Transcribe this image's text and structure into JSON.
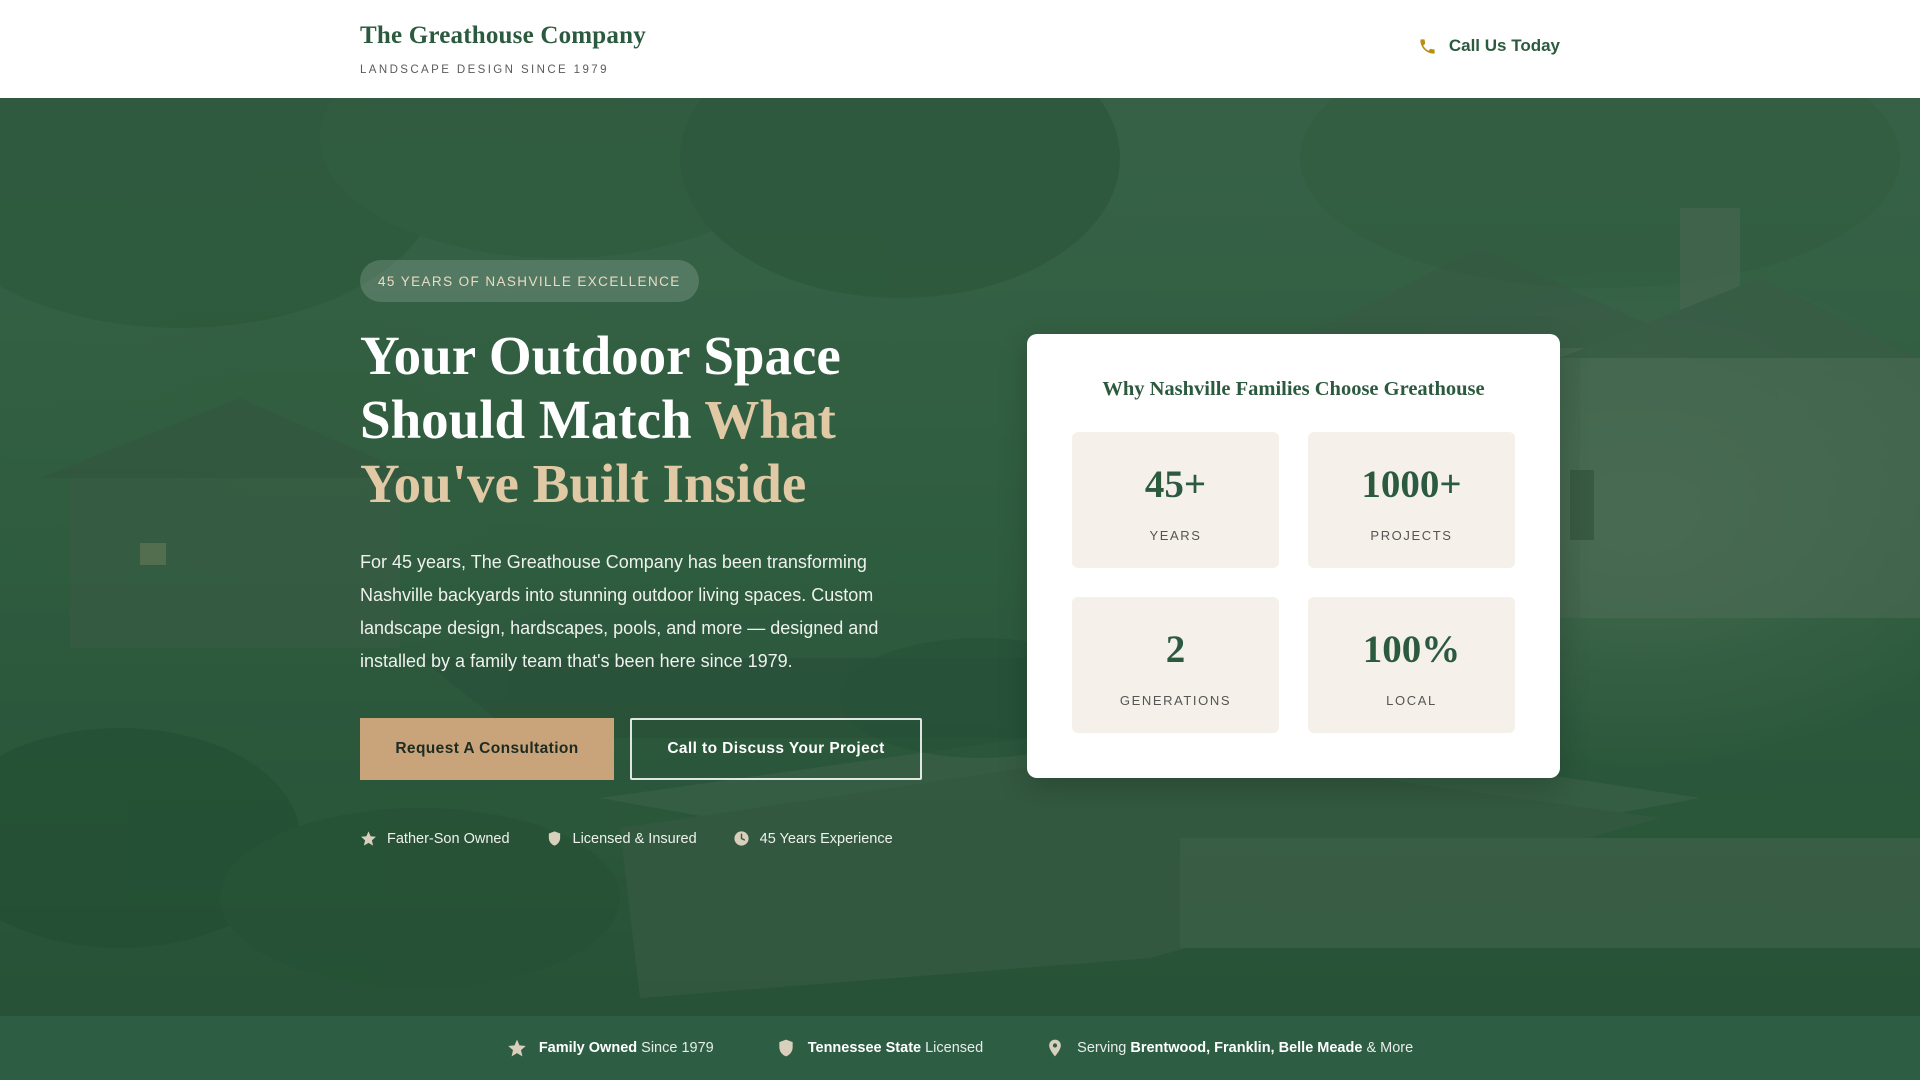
{
  "header": {
    "brand_name": "The Greathouse Company",
    "brand_tagline": "LANDSCAPE DESIGN SINCE 1979",
    "call_label": "Call Us Today"
  },
  "hero": {
    "badge": "45 YEARS OF NASHVILLE EXCELLENCE",
    "headline_line1": "Your Outdoor Space",
    "headline_line2_plain": "Should Match ",
    "headline_line2_accent": "What",
    "headline_line3_accent": "You've Built Inside",
    "lead": "For 45 years, The Greathouse Company has been transforming Nashville backyards into stunning outdoor living spaces. Custom landscape design, hardscapes, pools, and more — designed and installed by a family team that's been here since 1979.",
    "primary_button": "Request A Consultation",
    "secondary_button": "Call to Discuss Your Project",
    "trust_items": [
      {
        "label": "Father-Son Owned",
        "icon": "star-icon"
      },
      {
        "label": "Licensed & Insured",
        "icon": "shield-icon"
      },
      {
        "label": "45 Years Experience",
        "icon": "clock-icon"
      }
    ]
  },
  "stats_card": {
    "title": "Why Nashville Families Choose Greathouse",
    "stats": [
      {
        "value": "45+",
        "label": "YEARS"
      },
      {
        "value": "1000+",
        "label": "PROJECTS"
      },
      {
        "value": "2",
        "label": "GENERATIONS"
      },
      {
        "value": "100%",
        "label": "LOCAL"
      }
    ]
  },
  "bottom_bar": {
    "item1_bold": "Family Owned",
    "item1_rest": " Since 1979",
    "item2_bold": "Tennessee State",
    "item2_rest": " Licensed",
    "item3_prefix": "Serving ",
    "item3_bold": "Brentwood, Franklin, Belle Meade",
    "item3_rest": " & More"
  },
  "colors": {
    "brand_green": "#2c5a3f",
    "accent_tan": "#c9a47a",
    "headline_accent": "#e0c9a4",
    "icon_gold": "#b8900f",
    "stat_tile_bg": "#f5f1ea"
  }
}
